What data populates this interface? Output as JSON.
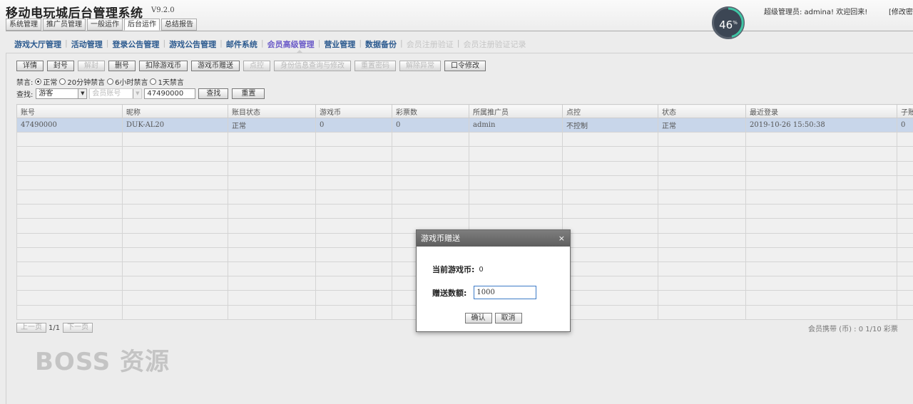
{
  "header": {
    "title": "移动电玩城后台管理系统",
    "version": "V9.2.0",
    "tabs": [
      "系统管理",
      "推广员管理",
      "一般运作",
      "后台运作",
      "总结报告"
    ],
    "progress": "46",
    "progress_unit": "%",
    "user_info": "超级管理员: admina! 欢迎回来!",
    "edit_link": "[修改密"
  },
  "nav": {
    "items": [
      {
        "label": "游戏大厅管理"
      },
      {
        "label": "活动管理"
      },
      {
        "label": "登录公告管理"
      },
      {
        "label": "游戏公告管理"
      },
      {
        "label": "邮件系统"
      },
      {
        "label": "会员高级管理"
      },
      {
        "label": "营业管理"
      },
      {
        "label": "数据备份"
      },
      {
        "label": "会员注册验证"
      },
      {
        "label": "会员注册验证记录"
      }
    ]
  },
  "toolbar": {
    "buttons": [
      "详情",
      "封号",
      "解封",
      "删号",
      "扣除游戏币",
      "游戏币赠送",
      "点控",
      "身份信息查询与修改",
      "重置密码",
      "解除异常",
      "口令修改"
    ]
  },
  "ban": {
    "label": "禁言:",
    "options": [
      "正常",
      "20分钟禁言",
      "6小时禁言",
      "1天禁言"
    ]
  },
  "search": {
    "label": "查找:",
    "type_value": "游客",
    "field_value": "会员账号",
    "query_value": "47490000",
    "search_button": "查找",
    "reset_button": "重置"
  },
  "table": {
    "columns": [
      "账号",
      "昵称",
      "账目状态",
      "游戏币",
      "彩票数",
      "所属推广员",
      "点控",
      "状态",
      "最近登录",
      "子账"
    ],
    "rows": [
      [
        "47490000",
        "DUK-AL20",
        "正常",
        "0",
        "0",
        "admin",
        "不控制",
        "正常",
        "2019-10-26 15:50:38",
        "0"
      ]
    ]
  },
  "pager": {
    "prev": "上一页",
    "page": "1/1",
    "next": "下一页"
  },
  "footer_sum": "会员携带 (币) : 0   1/10 彩票",
  "watermark": "BOSS 资源",
  "dialog": {
    "title": "游戏币赠送",
    "close": "×",
    "current_label": "当前游戏币:",
    "current_value": "0",
    "amount_label": "赠送数额:",
    "amount_value": "1000",
    "confirm": "确认",
    "cancel": "取消"
  }
}
